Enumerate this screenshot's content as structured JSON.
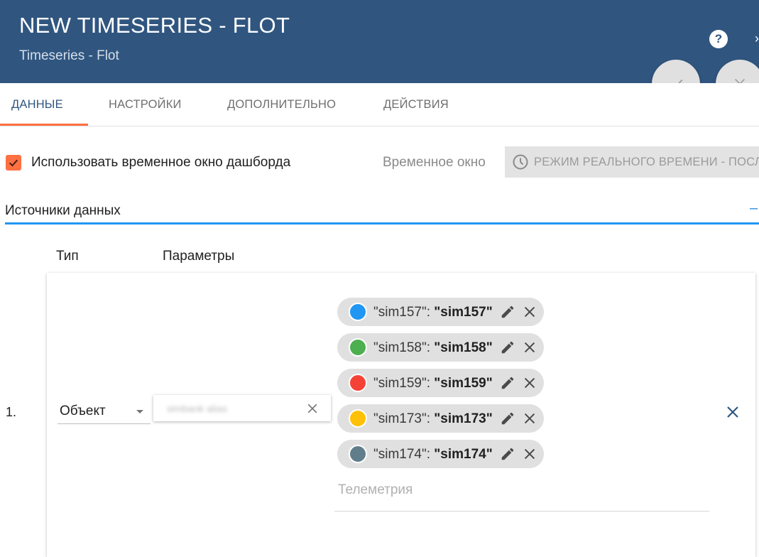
{
  "header": {
    "title": "NEW TIMESERIES - FLOT",
    "subtitle": "Timeseries - Flot",
    "help_icon": "help-circle-icon",
    "help_glyph": "?",
    "more_glyph": "›",
    "colors": {
      "background": "#305680",
      "text": "#ffffff"
    }
  },
  "actions": {
    "apply_icon": "check-icon",
    "close_icon": "close-icon"
  },
  "tabs": [
    {
      "label": "ДАННЫЕ",
      "active": true
    },
    {
      "label": "НАСТРОЙКИ",
      "active": false
    },
    {
      "label": "ДОПОЛНИТЕЛЬНО",
      "active": false
    },
    {
      "label": "ДЕЙСТВИЯ",
      "active": false
    }
  ],
  "timewindow": {
    "use_dashboard_label": "Использовать временное окно дашборда",
    "use_dashboard_checked": true,
    "label": "Временное окно",
    "button_text": "РЕЖИМ РЕАЛЬНОГО ВРЕМЕНИ - ПОСЛЕДНИЕ",
    "icon": "clock-icon"
  },
  "datasources": {
    "section_title": "Источники данных",
    "toggle_glyph": "–",
    "column_type": "Тип",
    "column_params": "Параметры",
    "rows": [
      {
        "index": "1.",
        "type_value": "Объект",
        "alias_value": "simbank alias",
        "keys": [
          {
            "key": "\"sim157\": ",
            "label": "\"sim157\"",
            "color": "#2196f3"
          },
          {
            "key": "\"sim158\": ",
            "label": "\"sim158\"",
            "color": "#4caf50"
          },
          {
            "key": "\"sim159\": ",
            "label": "\"sim159\"",
            "color": "#f44336"
          },
          {
            "key": "\"sim173\": ",
            "label": "\"sim173\"",
            "color": "#ffc107"
          },
          {
            "key": "\"sim174\": ",
            "label": "\"sim174\"",
            "color": "#607d8b"
          }
        ],
        "telemetry_placeholder": "Телеметрия"
      }
    ]
  },
  "accent_colors": {
    "tab_ink": "#ff7043",
    "checkbox": "#ff7043",
    "section_line": "#2196f3"
  }
}
